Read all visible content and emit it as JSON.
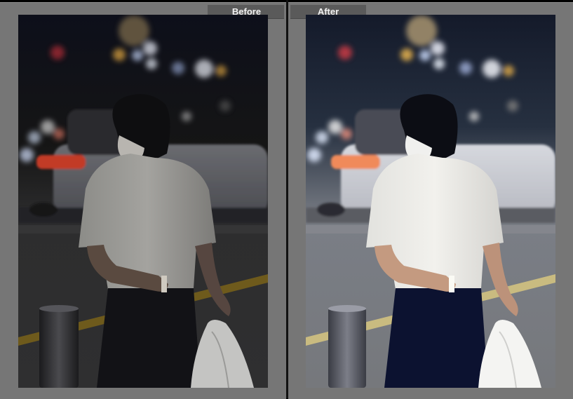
{
  "compare_view": {
    "before_label": "Before",
    "after_label": "After"
  },
  "photo": {
    "subject": "person-back-white-shirt-night-street",
    "before_tone": "dark",
    "after_tone": "bright"
  },
  "colors": {
    "panel_bg": "#767676",
    "tab_bg": "#5a5a5a",
    "divider": "#111111"
  }
}
